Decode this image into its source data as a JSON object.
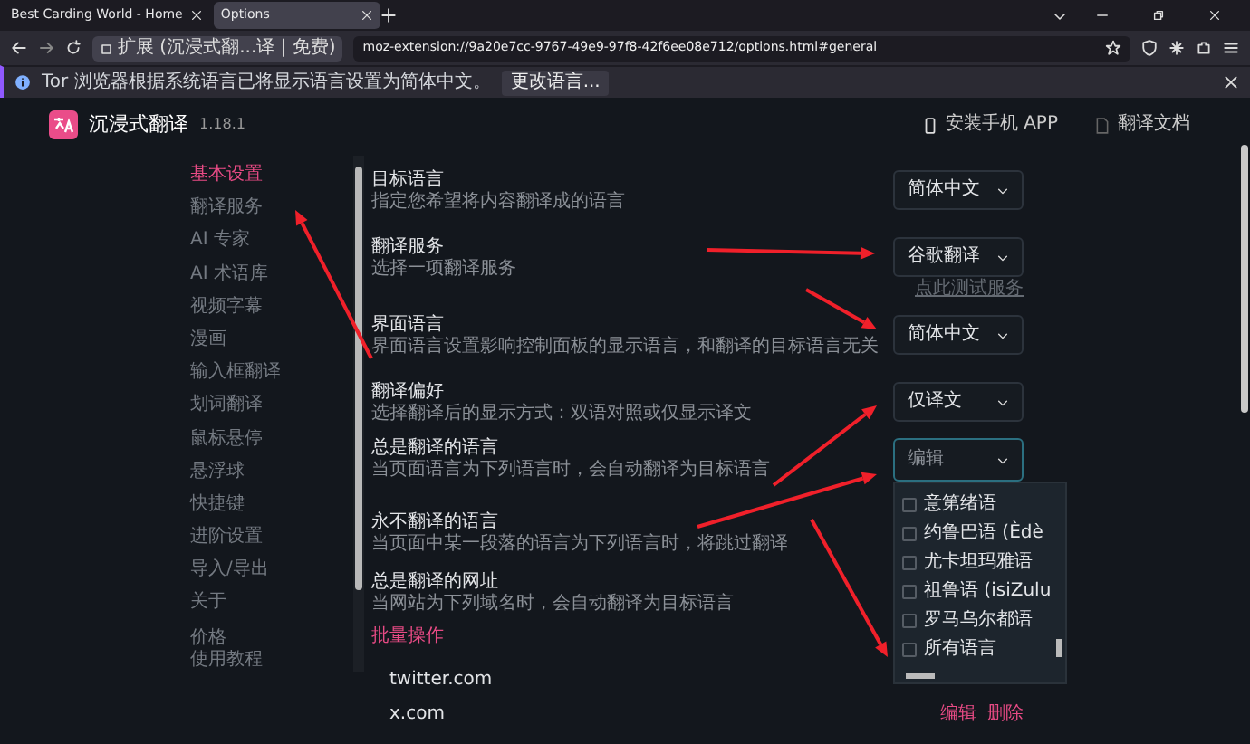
{
  "browser": {
    "tabs": [
      {
        "title": "Best Carding World - Home",
        "selected": false
      },
      {
        "title": "Options",
        "selected": true
      }
    ],
    "identity": "扩展 (沉浸式翻...译 | 免费)",
    "url": "moz-extension://9a20e7cc-9767-49e9-97f8-42f6ee08e712/options.html#general",
    "notification": {
      "message": "Tor 浏览器根据系统语言已将显示语言设置为简体中文。",
      "button": "更改语言..."
    }
  },
  "app": {
    "name": "沉浸式翻译",
    "version": "1.18.1",
    "header_links": [
      "安装手机 APP",
      "翻译文档"
    ]
  },
  "sidebar": {
    "items": [
      {
        "label": "基本设置",
        "selected": true
      },
      {
        "label": "翻译服务",
        "selected": false
      },
      {
        "label": "AI 专家",
        "selected": false
      },
      {
        "label": "AI 术语库",
        "selected": false
      },
      {
        "label": "视频字幕",
        "selected": false
      },
      {
        "label": "漫画",
        "selected": false
      },
      {
        "label": "输入框翻译",
        "selected": false
      },
      {
        "label": "划词翻译",
        "selected": false
      },
      {
        "label": "鼠标悬停",
        "selected": false
      },
      {
        "label": "悬浮球",
        "selected": false
      },
      {
        "label": "快捷键",
        "selected": false
      },
      {
        "label": "进阶设置",
        "selected": false
      },
      {
        "label": "导入/导出",
        "selected": false
      },
      {
        "label": "关于",
        "selected": false
      }
    ],
    "footer_links": [
      "价格",
      "使用教程"
    ]
  },
  "settings": [
    {
      "kind": "select",
      "title": "目标语言",
      "description": "指定您希望将内容翻译成的语言",
      "value": "简体中文"
    },
    {
      "kind": "select",
      "title": "翻译服务",
      "description": "选择一项翻译服务",
      "value": "谷歌翻译",
      "link": "点此测试服务"
    },
    {
      "kind": "select",
      "title": "界面语言",
      "description": "界面语言设置影响控制面板的显示语言，和翻译的目标语言无关",
      "value": "简体中文"
    },
    {
      "kind": "select",
      "title": "翻译偏好",
      "description": "选择翻译后的显示方式：双语对照或仅显示译文",
      "value": "仅译文"
    },
    {
      "kind": "multiselect",
      "title": "总是翻译的语言",
      "description": "当页面语言为下列语言时，会自动翻译为目标语言",
      "placeholder": "编辑",
      "expanded": true,
      "options": [
        {
          "label": "意第绪语",
          "checked": false
        },
        {
          "label": "约鲁巴语 (Èdè",
          "checked": false
        },
        {
          "label": "尤卡坦玛雅语",
          "checked": false
        },
        {
          "label": "祖鲁语 (isiZulu",
          "checked": false
        },
        {
          "label": "罗马乌尔都语",
          "checked": false
        },
        {
          "label": "所有语言",
          "checked": false
        }
      ]
    },
    {
      "kind": "plain",
      "title": "永不翻译的语言",
      "description": "当页面中某一段落的语言为下列语言时，将跳过翻译"
    },
    {
      "kind": "sites",
      "title": "总是翻译的网址",
      "description": "当网站为下列域名时，会自动翻译为目标语言",
      "batch": "批量操作",
      "sites": [
        {
          "domain": "twitter.com"
        },
        {
          "domain": "x.com",
          "actions": [
            "编辑",
            "删除"
          ]
        }
      ]
    }
  ]
}
